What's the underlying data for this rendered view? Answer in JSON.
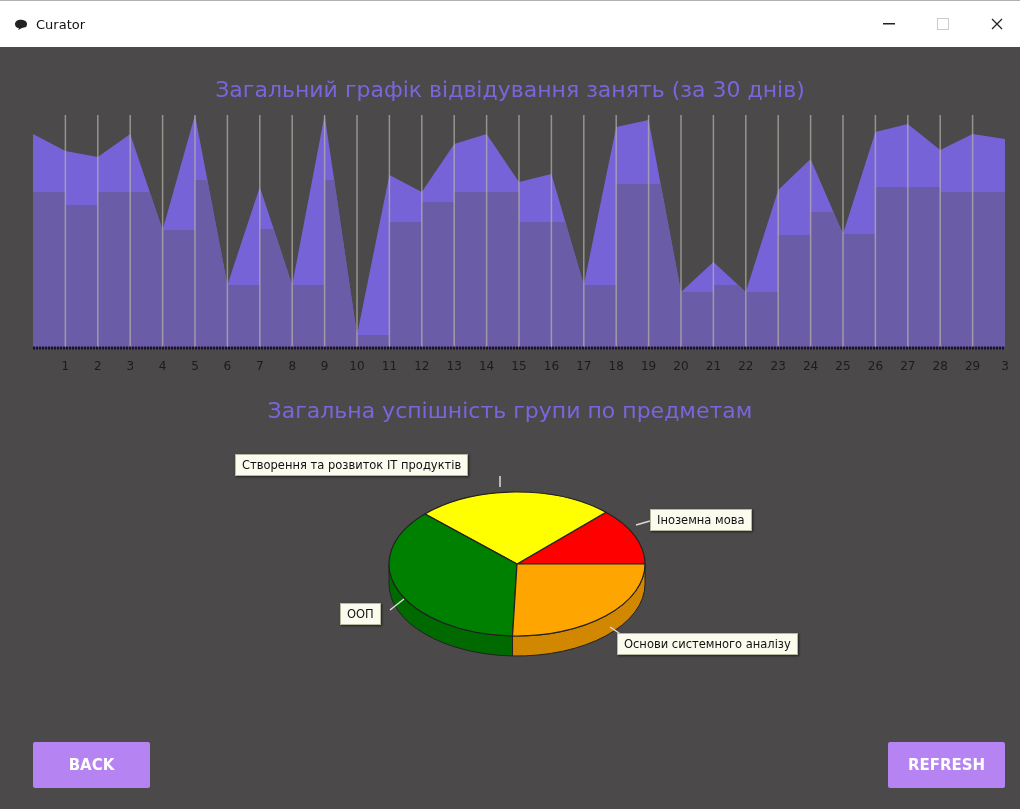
{
  "window": {
    "title": "Curator"
  },
  "attendance_chart": {
    "title": "Загальний графік відвідування занять (за 30 днів)",
    "x_labels": [
      "1",
      "2",
      "3",
      "4",
      "5",
      "6",
      "7",
      "8",
      "9",
      "10",
      "11",
      "12",
      "13",
      "14",
      "15",
      "16",
      "17",
      "18",
      "19",
      "20",
      "21",
      "22",
      "23",
      "24",
      "25",
      "26",
      "27",
      "28",
      "29",
      "3"
    ]
  },
  "pie_chart": {
    "title": "Загальна успішність групи по предметам",
    "slices": [
      {
        "label": "Іноземна мова",
        "color": "#ff0000"
      },
      {
        "label": "Створення та розвиток IT продуктів",
        "color": "#ffff00"
      },
      {
        "label": "ООП",
        "color": "#008000"
      },
      {
        "label": "Основи системного аналізу",
        "color": "#ffa500"
      }
    ]
  },
  "buttons": [
    {
      "label": "BACK"
    },
    {
      "label": "REFRESH"
    }
  ]
}
